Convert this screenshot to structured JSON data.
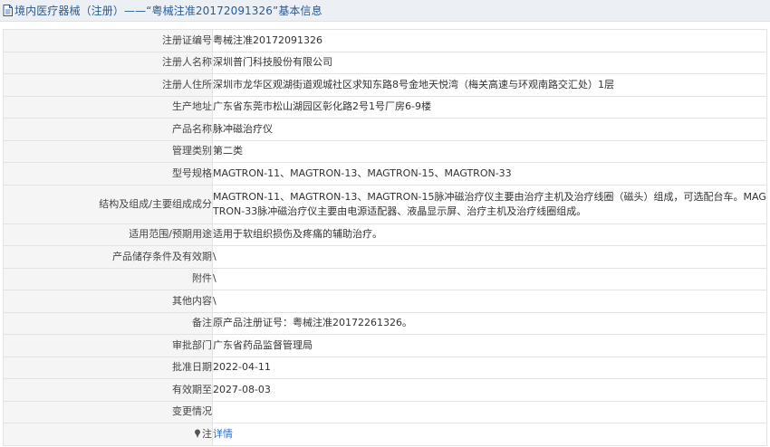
{
  "page": {
    "title": "境内医疗器械（注册）——“粤械注准20172091326”基本信息"
  },
  "rows": [
    {
      "label": "注册证编号",
      "value": "粤械注准20172091326"
    },
    {
      "label": "注册人名称",
      "value": "深圳普门科技股份有限公司"
    },
    {
      "label": "注册人住所",
      "value": "深圳市龙华区观湖街道观城社区求知东路8号金地天悦湾（梅关高速与环观南路交汇处）1层"
    },
    {
      "label": "生产地址",
      "value": "广东省东莞市松山湖园区彰化路2号1号厂房6-9楼"
    },
    {
      "label": "产品名称",
      "value": "脉冲磁治疗仪"
    },
    {
      "label": "管理类别",
      "value": "第二类"
    },
    {
      "label": "型号规格",
      "value": "MAGTRON-11、MAGTRON-13、MAGTRON-15、MAGTRON-33"
    },
    {
      "label": "结构及组成/主要组成成分",
      "value": "MAGTRON-11、MAGTRON-13、MAGTRON-15脉冲磁治疗仪主要由治疗主机及治疗线圈（磁头）组成，可选配台车。MAGTRON-33脉冲磁治疗仪主要由电源适配器、液晶显示屏、治疗主机及治疗线圈组成。"
    },
    {
      "label": "适用范围/预期用途",
      "value": "适用于软组织损伤及疼痛的辅助治疗。"
    },
    {
      "label": "产品储存条件及有效期",
      "value": "\\"
    },
    {
      "label": "附件",
      "value": "\\"
    },
    {
      "label": "其他内容",
      "value": "\\"
    },
    {
      "label": "备注",
      "value": "原产品注册证号：粤械注准20172261326。"
    },
    {
      "label": "审批部门",
      "value": "广东省药品监督管理局"
    },
    {
      "label": "批准日期",
      "value": "2022-04-11"
    },
    {
      "label": "有效期至",
      "value": "2027-08-03"
    },
    {
      "label": "变更情况",
      "value": ""
    }
  ],
  "note_row": {
    "label": "注",
    "link": "详情"
  },
  "colors": {
    "title": "#2a5a92",
    "link": "#2f6fc0",
    "label_bg": "#f5f5f5",
    "border": "#e3e3e3"
  }
}
